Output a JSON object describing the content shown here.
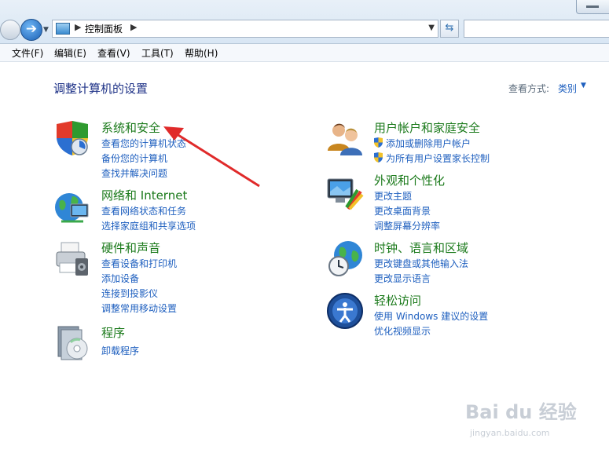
{
  "address": {
    "path": "控制面板"
  },
  "menu": [
    "文件(F)",
    "编辑(E)",
    "查看(V)",
    "工具(T)",
    "帮助(H)"
  ],
  "content": {
    "title": "调整计算机的设置",
    "view_label": "查看方式:",
    "view_value": "类别"
  },
  "categories": [
    {
      "title": "系统和安全",
      "icon": "shield-icon",
      "links": [
        "查看您的计算机状态",
        "备份您的计算机",
        "查找并解决问题"
      ]
    },
    {
      "title": "网络和 Internet",
      "icon": "network-globe-icon",
      "links": [
        "查看网络状态和任务",
        "选择家庭组和共享选项"
      ]
    },
    {
      "title": "硬件和声音",
      "icon": "printer-icon",
      "links": [
        "查看设备和打印机",
        "添加设备",
        "连接到投影仪",
        "调整常用移动设置"
      ]
    },
    {
      "title": "程序",
      "icon": "program-cd-icon",
      "links": [
        "卸载程序"
      ]
    },
    {
      "title": "用户帐户和家庭安全",
      "icon": "users-icon",
      "links": [
        "添加或删除用户帐户",
        "为所有用户设置家长控制"
      ]
    },
    {
      "title": "外观和个性化",
      "icon": "monitor-palette-icon",
      "links": [
        "更改主题",
        "更改桌面背景",
        "调整屏幕分辨率"
      ]
    },
    {
      "title": "时钟、语言和区域",
      "icon": "globe-clock-icon",
      "links": [
        "更改键盘或其他输入法",
        "更改显示语言"
      ]
    },
    {
      "title": "轻松访问",
      "icon": "ease-of-access-icon",
      "links": [
        "使用 Windows 建议的设置",
        "优化视频显示"
      ]
    }
  ],
  "watermark": {
    "brand": "Bai du 经验",
    "url": "jingyan.baidu.com"
  },
  "colors": {
    "category_green": "#1b7a1b",
    "link_blue": "#1e5fbf",
    "title_blue": "#1e3287",
    "arrow_red": "#e02a2a"
  }
}
